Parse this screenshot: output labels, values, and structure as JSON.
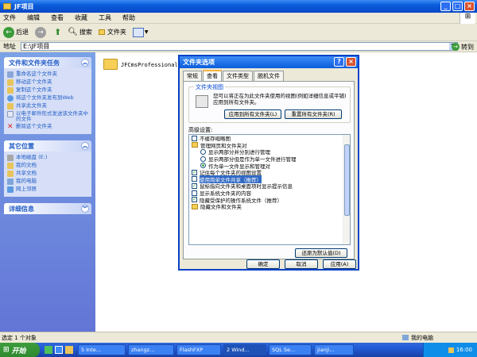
{
  "window": {
    "title": "JF项目",
    "close": "×",
    "min": "_",
    "max": "□"
  },
  "menu": [
    "文件",
    "编辑",
    "查看",
    "收藏",
    "工具",
    "帮助"
  ],
  "toolbar": {
    "back": "后退",
    "search": "搜索",
    "folders": "文件夹"
  },
  "address": {
    "label": "地址",
    "value": "E:\\JF项目",
    "go": "转到"
  },
  "sidebar": {
    "tasks": {
      "title": "文件和文件夹任务",
      "items": [
        "重命名这个文件夹",
        "移动这个文件夹",
        "复制这个文件夹",
        "将这个文件夹发布到Web",
        "共享此文件夹",
        "以电子邮件形式发送该文件夹中的文件",
        "删除这个文件夹"
      ]
    },
    "places": {
      "title": "其它位置",
      "items": [
        "本地磁盘 (E:)",
        "我的文档",
        "共享文档",
        "我的电脑",
        "网上邻居"
      ]
    },
    "details": {
      "title": "详细信息"
    }
  },
  "content": {
    "folder_name": "JFCmsProfessional4"
  },
  "dialog": {
    "title": "文件夹选项",
    "help": "?",
    "close": "×",
    "tabs": [
      "常规",
      "查看",
      "文件类型",
      "脱机文件"
    ],
    "group_label": "文件夹视图",
    "group_text": "您可以将正在为此文件夹使用的视图(例如详细信息或平铺)应用到所有文件夹。",
    "apply_all": "应用到所有文件夹(L)",
    "reset_all": "重置所有文件夹(R)",
    "advanced_label": "高级设置:",
    "restore": "还原为默认值(D)",
    "ok": "确定",
    "cancel": "取消",
    "apply": "应用(A)",
    "settings": [
      {
        "type": "check",
        "checked": false,
        "text": "不缓存缩略图",
        "indent": 1
      },
      {
        "type": "folder",
        "text": "管理网页和文件夹对",
        "indent": 1
      },
      {
        "type": "radio",
        "on": false,
        "text": "显示两部分并分别进行管理",
        "indent": 2
      },
      {
        "type": "radio",
        "on": false,
        "text": "显示两部分但是作为单一文件进行管理",
        "indent": 2
      },
      {
        "type": "radio",
        "on": true,
        "text": "作为单一文件显示和管理对",
        "indent": 2
      },
      {
        "type": "check",
        "checked": true,
        "text": "记住每个文件夹的视图设置",
        "indent": 1
      },
      {
        "type": "check",
        "checked": false,
        "text": "使用简单文件共享（推荐）",
        "indent": 1,
        "selected": true
      },
      {
        "type": "check",
        "checked": true,
        "text": "鼠标指向文件夹和桌面项时显示提示信息",
        "indent": 1
      },
      {
        "type": "check",
        "checked": false,
        "text": "显示系统文件夹的内容",
        "indent": 1
      },
      {
        "type": "check",
        "checked": true,
        "text": "隐藏受保护的操作系统文件（推荐）",
        "indent": 1
      },
      {
        "type": "folder",
        "text": "隐藏文件和文件夹",
        "indent": 1
      }
    ]
  },
  "status": {
    "left": "选定 1 个对象",
    "right": "我的电脑"
  },
  "taskbar": {
    "start": "开始",
    "tasks": [
      "5 Inte...",
      "zhangz...",
      "FlashFXP",
      "2 Wind...",
      "SQL Se...",
      "jianji..."
    ],
    "clock": "16:00"
  }
}
